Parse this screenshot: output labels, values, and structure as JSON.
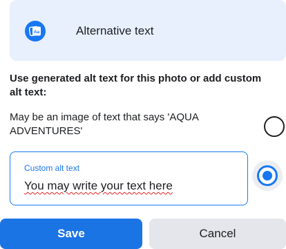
{
  "header": {
    "title": "Alternative text",
    "icon": "alt-text-icon"
  },
  "prompt": "Use generated alt text for this photo or add custom alt text:",
  "generated_option": {
    "label": "May be an image of text that says 'AQUA ADVENTURES'",
    "selected": false
  },
  "custom_option": {
    "label": "Custom alt text",
    "value": "You may write your text here",
    "selected": true
  },
  "buttons": {
    "save": "Save",
    "cancel": "Cancel"
  },
  "colors": {
    "accent": "#1877f2",
    "header_bg": "#e7f0fc",
    "cancel_bg": "#e4e6eb"
  }
}
